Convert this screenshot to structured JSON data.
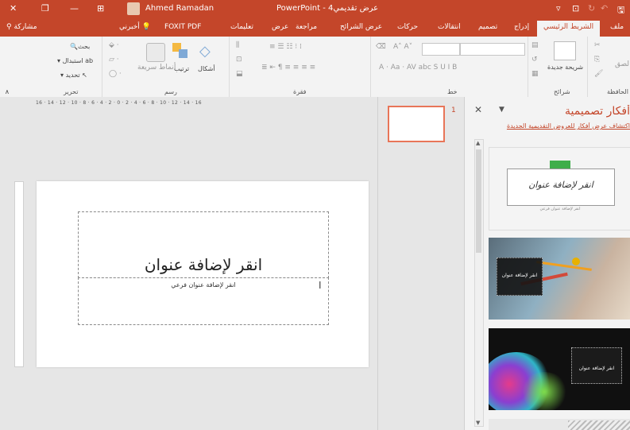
{
  "titlebar": {
    "app_title": "PowerPoint - عرض تقديمي4",
    "user_name": "Ahmed Ramadan"
  },
  "tabs": {
    "file": "ملف",
    "home": "الشريط الرئيسي",
    "insert": "إدراج",
    "design": "تصميم",
    "transitions": "انتقالات",
    "animations": "حركات",
    "slideshow": "عرض الشرائح",
    "review": "مراجعة",
    "view": "عرض",
    "help": "تعليمات",
    "foxit": "FOXIT PDF",
    "tellme": "أخبرني",
    "share": "مشاركة"
  },
  "ribbon": {
    "clipboard_label": "الحافظة",
    "paste_label": "لصق",
    "new_slide_label": "شريحة جديدة",
    "slides_label": "شرائح",
    "font_label": "خط",
    "paragraph_label": "فقرة",
    "drawing_label": "رسم",
    "shapes_label": "أشكال",
    "arrange_label": "ترتيب",
    "quick_styles_label": "أنماط سريعة",
    "editing_label": "تحرير",
    "find_label": "بحث",
    "replace_label": "استبدال",
    "select_label": "تحديد"
  },
  "ruler": {
    "horizontal_text": "16 · 14 · 12 · 10 · 8 · 6 · 4 · 2 · 0 · 2 · 4 · 6 · 8 · 10 · 12 · 14 · 16"
  },
  "slide": {
    "title_placeholder": "انقر لإضافة عنوان",
    "subtitle_placeholder": "انقر لإضافة عنوان فرعي"
  },
  "thumbnails": {
    "slide_number": "1"
  },
  "design_ideas": {
    "title": "أفكار تصميمية",
    "link": "اكتشاف عرض أفكار للعروض التقديمية الجديدة",
    "idea_text": "انقر لإضافة عنوان",
    "idea_short": "انقر لإضافة عنوان",
    "idea_subtext": "انقر لإضافة عنوان فرعي"
  },
  "colors": {
    "accent": "#c4462a",
    "ribbon_bg": "#f3f3f3",
    "thumb_border": "#e87558"
  }
}
